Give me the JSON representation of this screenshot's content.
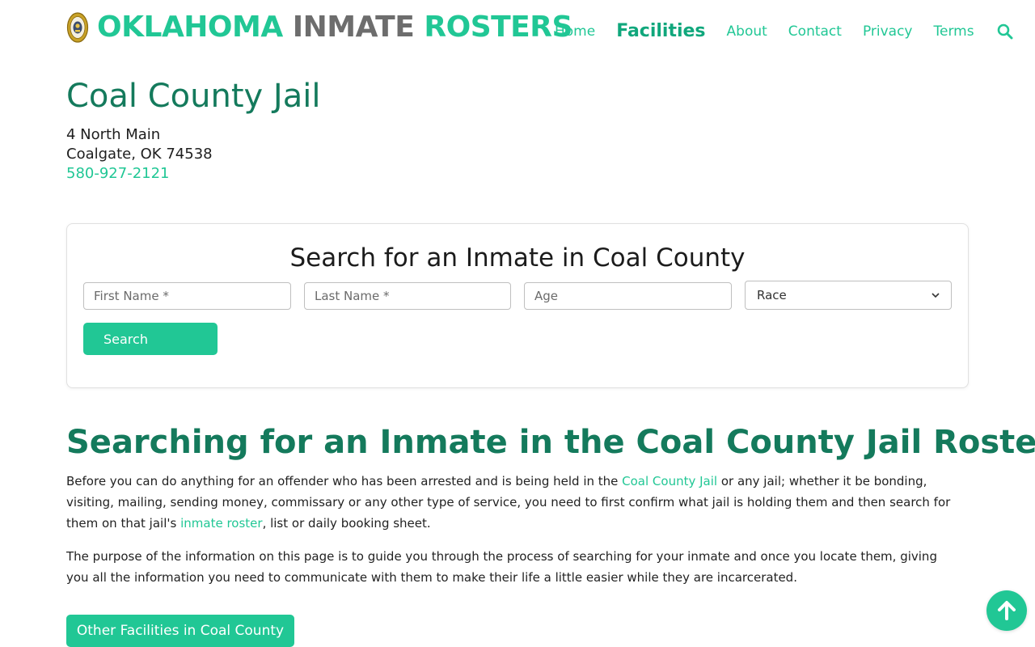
{
  "brand": {
    "part1": "OKLAHOMA",
    "part2": "INMATE",
    "part3": "ROSTERS",
    "logo_icon": "county-badge-icon"
  },
  "nav": {
    "items": [
      "Home",
      "Facilities",
      "About",
      "Contact",
      "Privacy",
      "Terms"
    ],
    "active": "Facilities",
    "search_icon": "search-icon"
  },
  "facility": {
    "name": "Coal County Jail",
    "address_line1": "4 North Main",
    "address_line2": "Coalgate, OK 74538",
    "phone": "580-927-2121"
  },
  "search_form": {
    "title": "Search for an Inmate in Coal County",
    "first_name_placeholder": "First Name *",
    "last_name_placeholder": "Last Name *",
    "age_placeholder": "Age",
    "race_selected": "Race",
    "submit_label": "Search"
  },
  "article": {
    "heading": "Searching for an Inmate in the Coal County Jail Roster",
    "p1_a": "Before you can do anything for an offender who has been arrested and is being held in the ",
    "p1_link1": "Coal County Jail",
    "p1_b": " or any jail; whether it be bonding, visiting, mailing, sending money, commissary or any other type of service, you need to first confirm what jail is holding them and then search for them on that jail's ",
    "p1_link2": "inmate roster",
    "p1_c": ", list or daily booking sheet.",
    "p2": "The purpose of the information on this page is to guide you through the process of searching for your inmate and once you locate them, giving you all the information you need to communicate with them to make their life a little easier while they are incarcerated.",
    "other_facilities_button": "Other Facilities in Coal County"
  },
  "back_to_top_icon": "arrow-up-icon",
  "colors": {
    "accent": "#21c795",
    "heading": "#147a5c",
    "brand_gray": "#6d6d6d"
  }
}
